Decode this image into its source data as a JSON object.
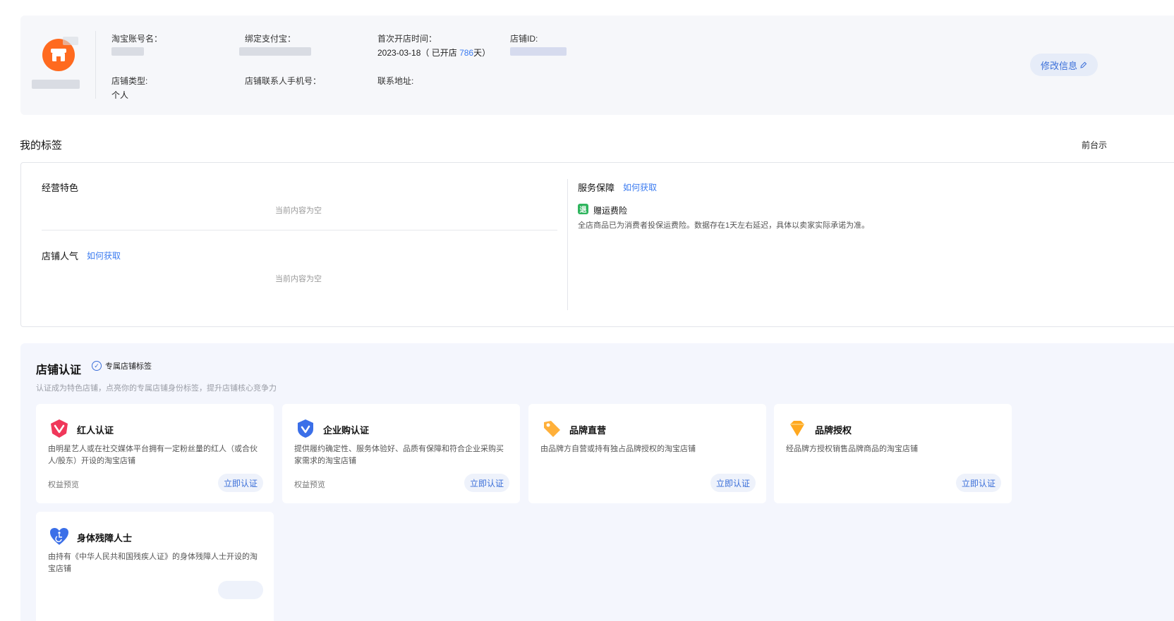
{
  "account": {
    "taobao_name_label": "淘宝账号名：",
    "alipay_label": "绑定支付宝：",
    "first_open_label": "首次开店时间：",
    "first_open_date": "2023-03-18",
    "open_prefix": "（ 已开店 ",
    "open_days": "786",
    "open_suffix": "天）",
    "shop_id_label": "店铺ID:",
    "shop_type_label": "店铺类型:",
    "shop_type_value": "个人",
    "contact_phone_label": "店铺联系人手机号：",
    "address_label": "联系地址:",
    "edit_button": "修改信息"
  },
  "tags": {
    "section_title": "我的标签",
    "preview_link": "前台示",
    "feature_title": "经营特色",
    "feature_empty": "当前内容为空",
    "popularity_title": "店铺人气",
    "popularity_link": "如何获取",
    "popularity_empty": "当前内容为空",
    "service_title": "服务保障",
    "service_link": "如何获取",
    "service_icon_char": "退",
    "service_item_name": "赠运费险",
    "service_item_desc": "全店商品已为消费者投保运费险。数据存在1天左右延迟，具体以卖家实际承诺为准。"
  },
  "cert": {
    "title": "店铺认证",
    "exclusive_label": "专属店铺标签",
    "subtitle": "认证成为特色店铺，点亮你的专属店铺身份标签，提升店铺核心竞争力",
    "cards": [
      {
        "name": "红人认证",
        "desc": "由明星艺人或在社交媒体平台拥有一定粉丝量的红人（或合伙人/股东）开设的淘宝店铺",
        "rights": "权益预览",
        "button": "立即认证",
        "icon": "red-v-shield-icon"
      },
      {
        "name": "企业购认证",
        "desc": "提供履约确定性、服务体验好、品质有保障和符合企业采购买家需求的淘宝店铺",
        "rights": "权益预览",
        "button": "立即认证",
        "icon": "blue-check-shield-icon"
      },
      {
        "name": "品牌直营",
        "desc": "由品牌方自营或持有独占品牌授权的淘宝店铺",
        "rights": "",
        "button": "立即认证",
        "icon": "orange-tag-icon"
      },
      {
        "name": "品牌授权",
        "desc": "经品牌方授权销售品牌商品的淘宝店铺",
        "rights": "",
        "button": "立即认证",
        "icon": "orange-diamond-icon"
      },
      {
        "name": "身体残障人士",
        "desc": "由持有《中华人民共和国残疾人证》的身体残障人士开设的淘宝店铺",
        "rights": "",
        "button": "",
        "icon": "blue-heart-icon"
      }
    ]
  },
  "colors": {
    "accent_blue": "#3b6fd9",
    "link_blue": "#3b7bf0",
    "logo_orange": "#ff6a1f",
    "panel_bg": "#f4f6fd"
  }
}
